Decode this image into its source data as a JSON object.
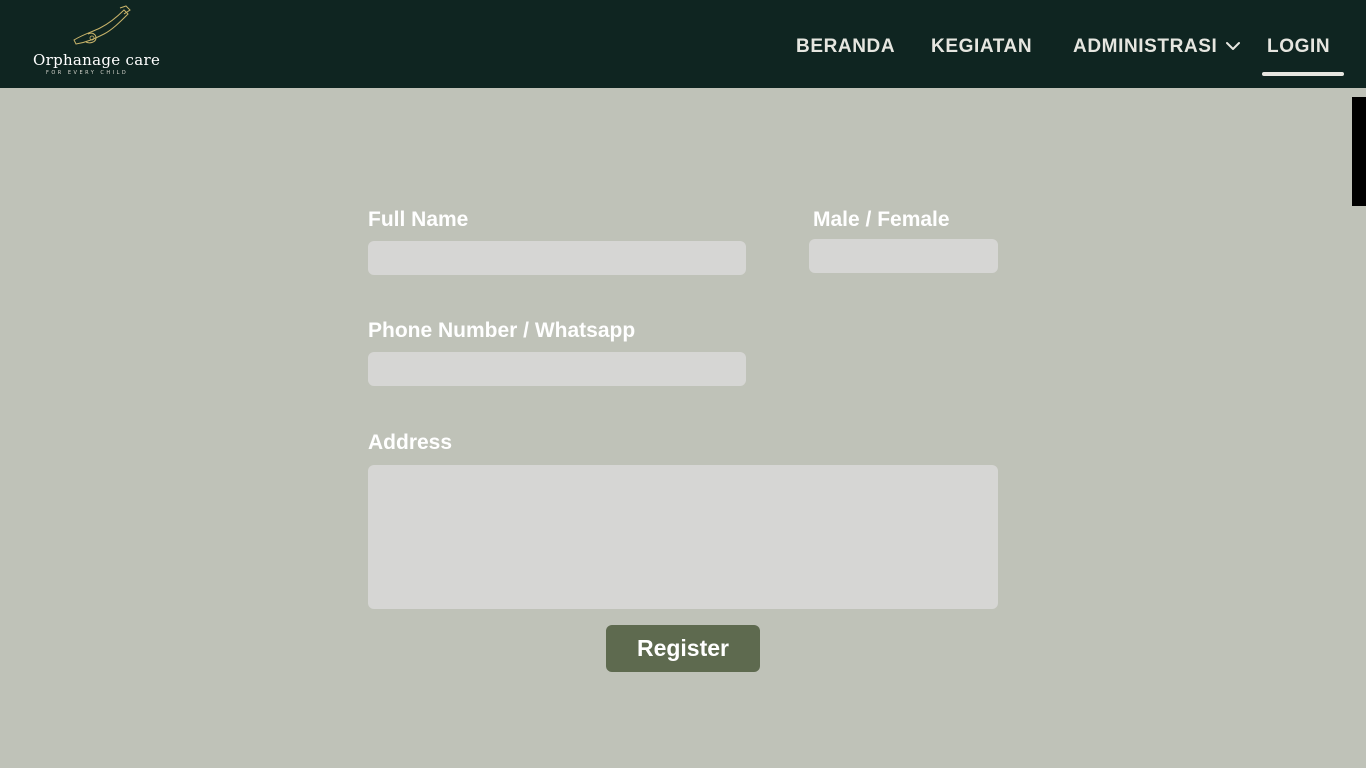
{
  "header": {
    "logo": {
      "title": "Orphanage care",
      "tagline": "FOR EVERY CHILD",
      "icon": "hands-logo-icon"
    },
    "nav": [
      {
        "label": "BERANDA"
      },
      {
        "label": "KEGIATAN"
      },
      {
        "label": "ADMINISTRASI",
        "icon": "chevron-down-icon"
      },
      {
        "label": "LOGIN",
        "active": true
      }
    ]
  },
  "form": {
    "full_name": {
      "label": "Full Name",
      "value": ""
    },
    "gender": {
      "label": "Male / Female",
      "value": ""
    },
    "phone": {
      "label": "Phone Number / Whatsapp",
      "value": ""
    },
    "address": {
      "label": "Address",
      "value": ""
    },
    "submit_label": "Register"
  },
  "colors": {
    "header_bg": "#0f2521",
    "page_bg": "#bfc2b8",
    "field_bg": "#d6d6d4",
    "button_bg": "#5e6a4f"
  }
}
